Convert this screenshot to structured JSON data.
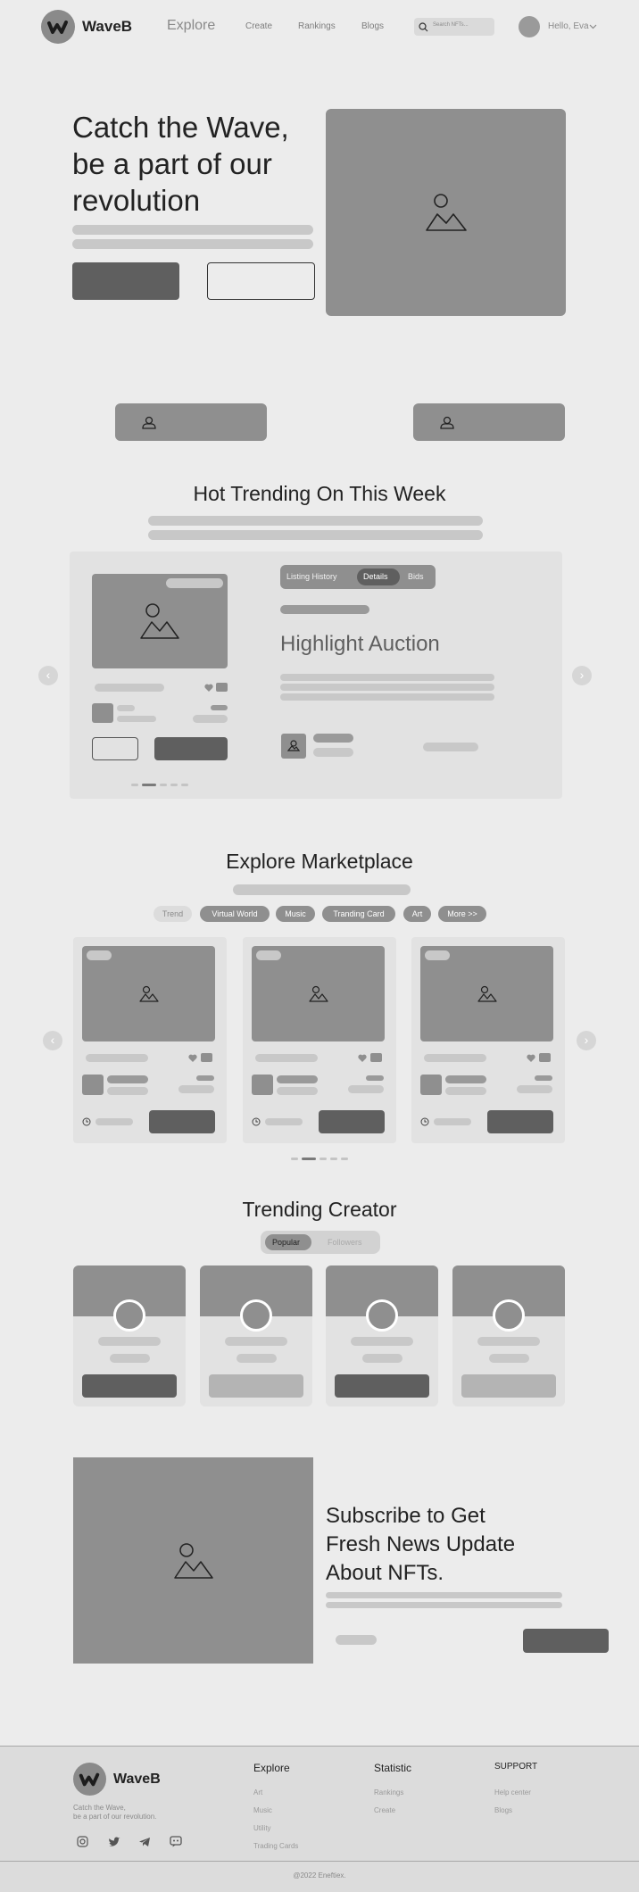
{
  "header": {
    "brand": "WaveB",
    "nav": {
      "explore": "Explore",
      "create": "Create",
      "rankings": "Rankings",
      "blogs": "Blogs"
    },
    "search_placeholder": "Search NFTs...",
    "greeting": "Hello, Eva"
  },
  "hero": {
    "title_line1": "Catch the Wave,",
    "title_line2": "be a part of our",
    "title_line3": "revolution"
  },
  "trending": {
    "title": "Hot Trending On This Week",
    "tabs": [
      "Listing History",
      "Details",
      "Bids"
    ],
    "active_tab": "Details",
    "auction_title": "Highlight Auction"
  },
  "marketplace": {
    "title": "Explore Marketplace",
    "filters": [
      "Trend",
      "Virtual World",
      "Music",
      "Tranding Card",
      "Art",
      "More >>"
    ],
    "active_filter": "Trend"
  },
  "creators": {
    "title": "Trending Creator",
    "tabs": [
      "Popular",
      "Followers"
    ],
    "active_tab": "Popular"
  },
  "subscribe": {
    "title_line1": "Subscribe to Get",
    "title_line2": "Fresh News Update",
    "title_line3": "About NFTs."
  },
  "footer": {
    "brand": "WaveB",
    "tagline1": "Catch the Wave,",
    "tagline2": "be a part of our revolution.",
    "explore_heading": "Explore",
    "explore_links": [
      "Art",
      "Music",
      "Utility",
      "Trading Cards"
    ],
    "statistic_heading": "Statistic",
    "statistic_links": [
      "Rankings",
      "Create"
    ],
    "support_heading": "SUPPORT",
    "support_links": [
      "Help center",
      "Blogs"
    ],
    "copyright": "@2022 Eneftiex."
  },
  "icons": [
    "logo-icon",
    "search-icon",
    "avatar",
    "image-icon",
    "heart-icon",
    "clock-icon",
    "chevron-left-icon",
    "chevron-right-icon",
    "instagram-icon",
    "twitter-icon",
    "telegram-icon",
    "discord-icon"
  ]
}
